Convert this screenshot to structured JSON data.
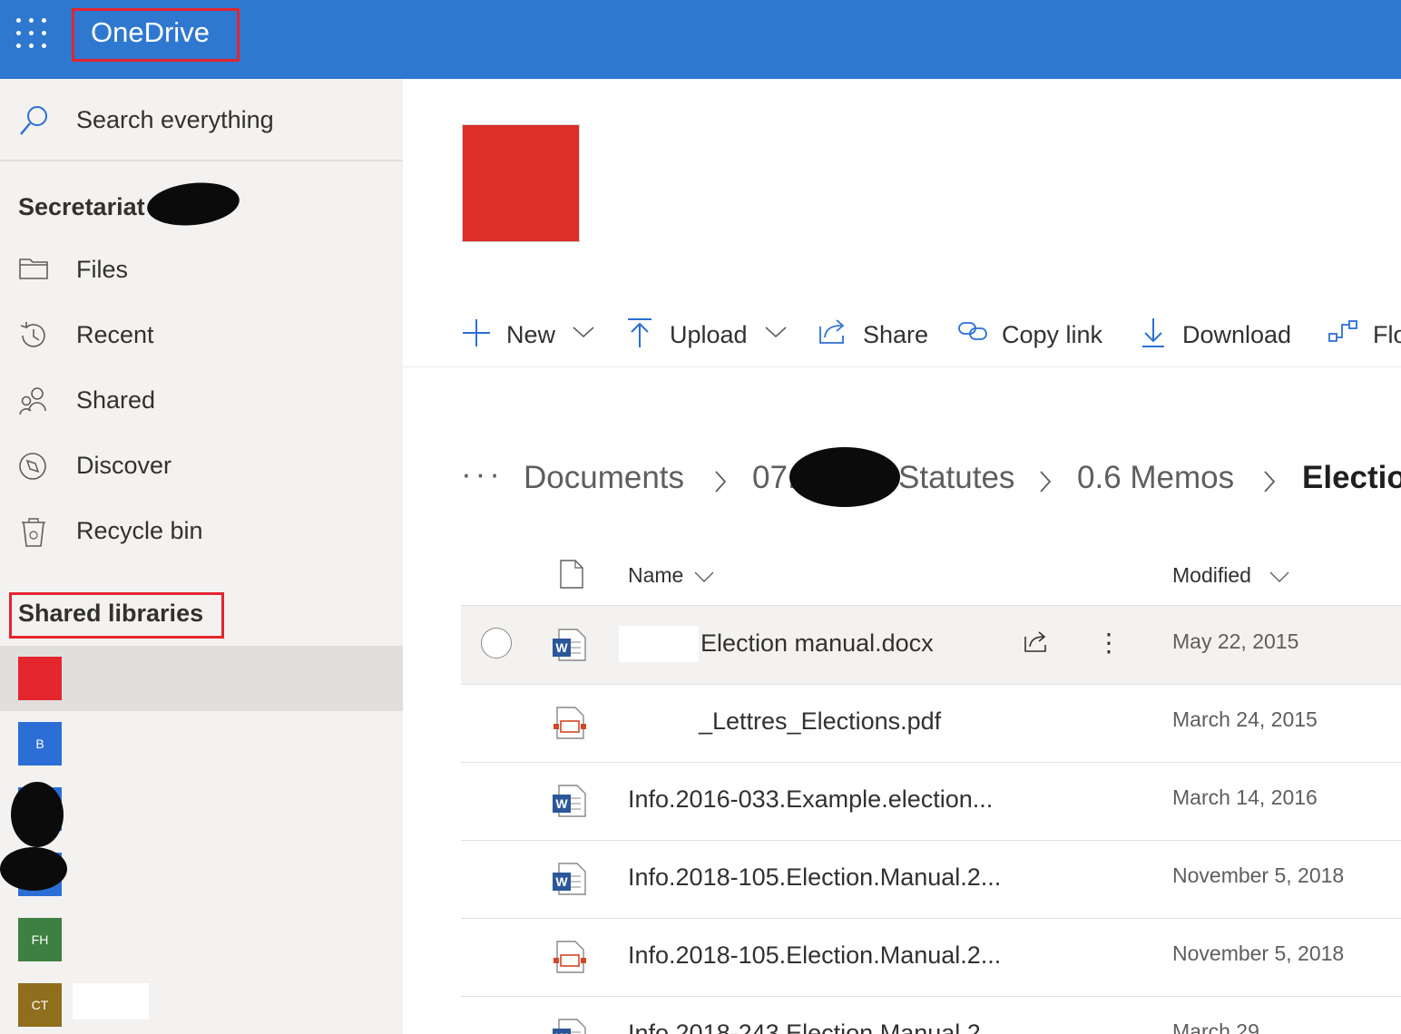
{
  "app": {
    "title": "OneDrive"
  },
  "sidebar": {
    "search_label": "Search everything",
    "site_title": "Secretariat",
    "nav": [
      {
        "label": "Files",
        "icon": "folder-icon"
      },
      {
        "label": "Recent",
        "icon": "history-icon"
      },
      {
        "label": "Shared",
        "icon": "people-icon"
      },
      {
        "label": "Discover",
        "icon": "compass-icon"
      },
      {
        "label": "Recycle bin",
        "icon": "recycle-bin-icon"
      }
    ],
    "libraries_title": "Shared libraries",
    "libraries": [
      {
        "initials": "",
        "color": "#e3262e"
      },
      {
        "initials": "B",
        "color": "#2b6fd6"
      },
      {
        "initials": "",
        "color": "#2b6fd6"
      },
      {
        "initials": "",
        "color": "#2b6fd6"
      },
      {
        "initials": "FH",
        "color": "#3d8041"
      },
      {
        "initials": "CT",
        "color": "#8f6e1d"
      }
    ]
  },
  "commands": {
    "new": "New",
    "upload": "Upload",
    "share": "Share",
    "copy_link": "Copy link",
    "download": "Download",
    "flow": "Flo"
  },
  "breadcrumb": {
    "items": [
      "Documents",
      "07.",
      "Statutes",
      "0.6 Memos"
    ],
    "current": "Electio"
  },
  "list": {
    "col_name": "Name",
    "col_modified": "Modified",
    "rows": [
      {
        "name": "Election manual.docx",
        "type": "word",
        "modified": "May 22, 2015"
      },
      {
        "name": "_Lettres_Elections.pdf",
        "type": "pdf",
        "modified": "March 24, 2015"
      },
      {
        "name": "Info.2016-033.Example.election...",
        "type": "word",
        "modified": "March 14, 2016"
      },
      {
        "name": "Info.2018-105.Election.Manual.2...",
        "type": "word",
        "modified": "November 5, 2018"
      },
      {
        "name": "Info.2018-105.Election.Manual.2...",
        "type": "pdf",
        "modified": "November 5, 2018"
      },
      {
        "name": "Info.2018-243.Election.Manual.2...",
        "type": "word",
        "modified": "March 29"
      }
    ]
  },
  "colors": {
    "brand_bar": "#2f78cf",
    "accent": "#0078d4",
    "highlight_box": "#e3262e",
    "hero_tile": "#db2f27"
  }
}
